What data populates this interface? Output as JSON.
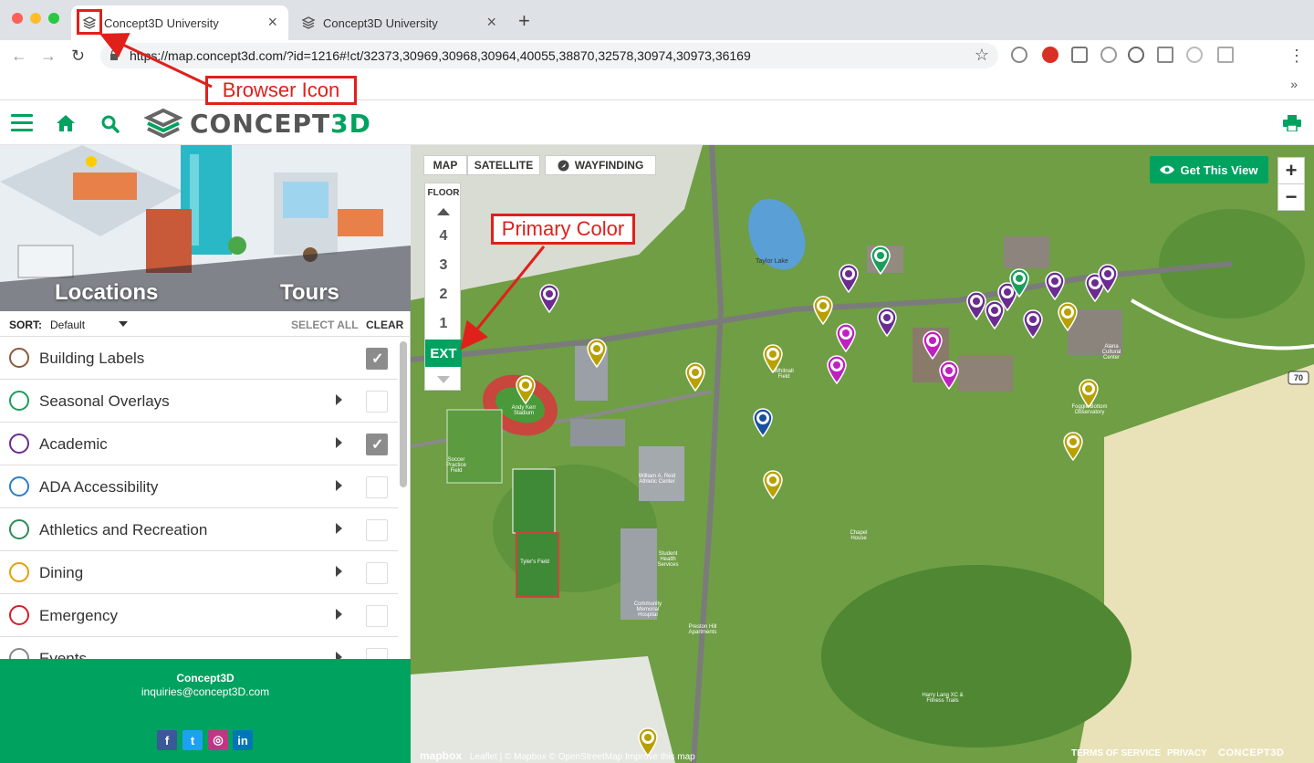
{
  "browser": {
    "tabs": [
      {
        "title": "Concept3D University",
        "active": true
      },
      {
        "title": "Concept3D University",
        "active": false
      }
    ],
    "new_tab_icon": "plus-icon",
    "url": "https://map.concept3d.com/?id=1216#!ct/32373,30969,30968,30964,40055,38870,32578,30974,30973,36169",
    "bookmarks_overflow": "»"
  },
  "header": {
    "brand_prefix": "CONCEPT",
    "brand_suffix": "3D",
    "primary_color": "#00a260"
  },
  "sidebar": {
    "hero_tabs": [
      "Locations",
      "Tours"
    ],
    "sort_label": "SORT:",
    "sort_value": "Default",
    "select_all": "SELECT ALL",
    "clear": "CLEAR",
    "categories": [
      {
        "label": "Building Labels",
        "icon": "label-icon",
        "color": "#8b5a3c",
        "checked": true,
        "expandable": false
      },
      {
        "label": "Seasonal Overlays",
        "icon": "tree-icon",
        "color": "#1a9e5c",
        "checked": false,
        "expandable": true
      },
      {
        "label": "Academic",
        "icon": "graduation-cap-icon",
        "color": "#6a2c91",
        "checked": true,
        "expandable": true
      },
      {
        "label": "ADA Accessibility",
        "icon": "wheelchair-icon",
        "color": "#2a7fc8",
        "checked": false,
        "expandable": true
      },
      {
        "label": "Athletics and Recreation",
        "icon": "field-icon",
        "color": "#2e8b57",
        "checked": false,
        "expandable": true
      },
      {
        "label": "Dining",
        "icon": "fork-knife-icon",
        "color": "#e8a000",
        "checked": false,
        "expandable": true
      },
      {
        "label": "Emergency",
        "icon": "cross-icon",
        "color": "#d2202a",
        "checked": false,
        "expandable": true
      },
      {
        "label": "Events",
        "icon": "flag-icon",
        "color": "#888888",
        "checked": false,
        "expandable": true
      }
    ],
    "footer": {
      "name": "Concept3D",
      "email": "inquiries@concept3D.com",
      "social": [
        {
          "icon": "facebook-icon",
          "glyph": "f",
          "color": "#3b5998"
        },
        {
          "icon": "twitter-icon",
          "glyph": "t",
          "color": "#1da1f2"
        },
        {
          "icon": "instagram-icon",
          "glyph": "◎",
          "color": "#c13584"
        },
        {
          "icon": "linkedin-icon",
          "glyph": "in",
          "color": "#0077b5"
        }
      ]
    }
  },
  "map": {
    "types": [
      "MAP",
      "SATELLITE",
      "WAYFINDING"
    ],
    "floor_title": "FLOOR",
    "floors": [
      "4",
      "3",
      "2",
      "1"
    ],
    "active_floor": "EXT",
    "get_view": "Get This View",
    "zoom_in": "+",
    "zoom_out": "−",
    "route_badge": "70",
    "labels": [
      "Taylor Lake",
      "Soccer Practice Field",
      "Andy Kerr Stadium",
      "William A. Reid Athletic Center",
      "Student Health Services",
      "Whitnall Field",
      "Community Memorial Hospital",
      "Preston Hill Apartments",
      "Chapel House",
      "Tyler's Field",
      "Harry Lang XC & Fitness Trails",
      "Alana Cultural Center",
      "Foggie Bottom Observatory"
    ],
    "attribution": "Leaflet | © Mapbox © OpenStreetMap Improve this map",
    "mapbox": "mapbox",
    "terms": "TERMS OF SERVICE",
    "privacy": "PRIVACY",
    "footer_logo": "CONCEPT3D"
  },
  "annotations": {
    "browser_icon": "Browser Icon",
    "primary_color": "Primary Color"
  }
}
